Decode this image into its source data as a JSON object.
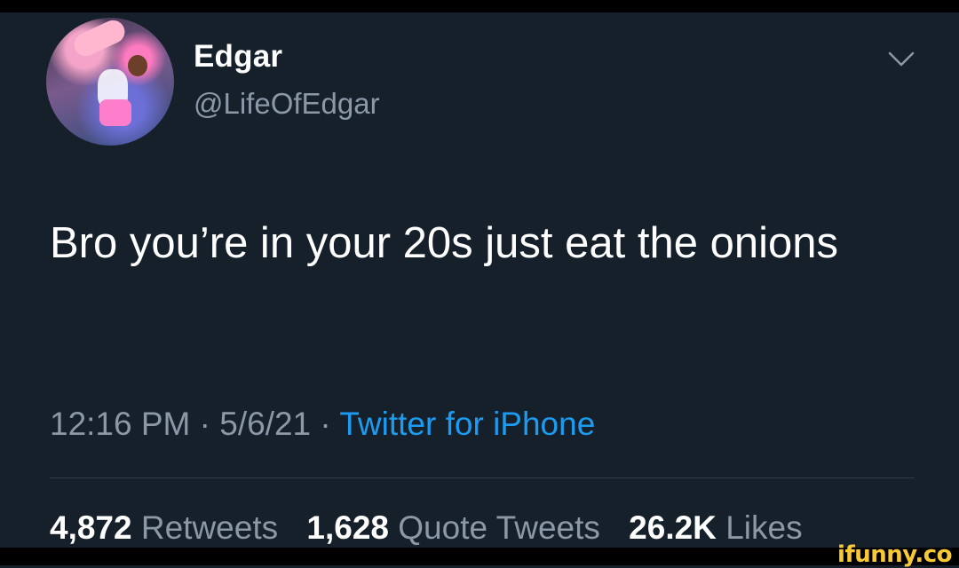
{
  "tweet": {
    "display_name": "Edgar",
    "handle": "@LifeOfEdgar",
    "text": "Bro you’re in your 20s just eat the onions",
    "time": "12:16 PM",
    "date": "5/6/21",
    "separator": "·",
    "source": "Twitter for iPhone"
  },
  "stats": {
    "retweets_count": "4,872",
    "retweets_label": "Retweets",
    "quotes_count": "1,628",
    "quotes_label": "Quote Tweets",
    "likes_count": "26.2K",
    "likes_label": "Likes"
  },
  "watermark": "ifunny.co",
  "colors": {
    "background": "#15202b",
    "secondary_text": "#8b98a5",
    "link": "#1d9bf0",
    "watermark": "#f7c934"
  },
  "icons": {
    "more_menu": "chevron-down-icon"
  }
}
